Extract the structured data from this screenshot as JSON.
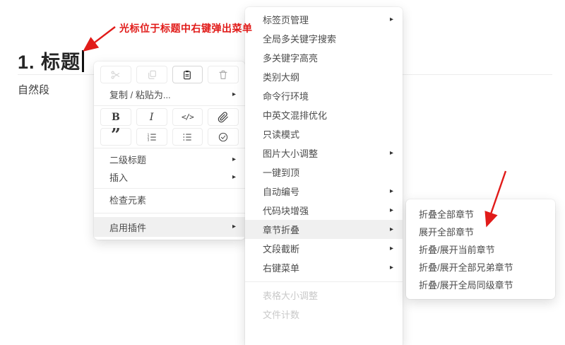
{
  "glyphs": {
    "submenu_arrow": "▸",
    "bold": "B",
    "italic": "I",
    "code": "</>",
    "quote": "”"
  },
  "colors": {
    "annotation_red": "#e11b19",
    "menu_highlight": "#f0f0f0",
    "disabled_text": "#c9c9c9"
  },
  "editor": {
    "heading": "1. 标题",
    "paragraph": "自然段"
  },
  "annotation": {
    "label": "光标位于标题中右键弹出菜单"
  },
  "context_menu": {
    "toolbar_icons": [
      {
        "name": "cut",
        "state": "disabled"
      },
      {
        "name": "copy",
        "state": "disabled"
      },
      {
        "name": "paste",
        "state": "active"
      },
      {
        "name": "delete",
        "state": "muted"
      }
    ],
    "format_icons": [
      "bold",
      "italic",
      "code",
      "link",
      "quote",
      "ordered-list",
      "unordered-list",
      "task-list"
    ],
    "items": [
      {
        "label": "复制 / 粘贴为...",
        "submenu": true
      },
      {
        "label": "二级标题",
        "submenu": true
      },
      {
        "label": "插入",
        "submenu": true
      },
      {
        "label": "检查元素",
        "submenu": false
      },
      {
        "label": "启用插件",
        "submenu": true,
        "highlighted": true
      }
    ]
  },
  "plugins_submenu": {
    "items": [
      {
        "label": "标签页管理",
        "submenu": true
      },
      {
        "label": "全局多关键字搜索"
      },
      {
        "label": "多关键字高亮"
      },
      {
        "label": "类别大纲"
      },
      {
        "label": "命令行环境"
      },
      {
        "label": "中英文混排优化"
      },
      {
        "label": "只读模式"
      },
      {
        "label": "图片大小调整",
        "submenu": true
      },
      {
        "label": "一键到顶"
      },
      {
        "label": "自动编号",
        "submenu": true
      },
      {
        "label": "代码块增强",
        "submenu": true
      },
      {
        "label": "章节折叠",
        "submenu": true,
        "highlighted": true
      },
      {
        "label": "文段截断",
        "submenu": true
      },
      {
        "label": "右键菜单",
        "submenu": true
      },
      {
        "label": "表格大小调整",
        "disabled": true
      },
      {
        "label": "文件计数",
        "disabled": true
      }
    ]
  },
  "fold_submenu": {
    "items": [
      {
        "label": "折叠全部章节"
      },
      {
        "label": "展开全部章节"
      },
      {
        "label": "折叠/展开当前章节"
      },
      {
        "label": "折叠/展开全部兄弟章节"
      },
      {
        "label": "折叠/展开全局同级章节"
      }
    ]
  }
}
